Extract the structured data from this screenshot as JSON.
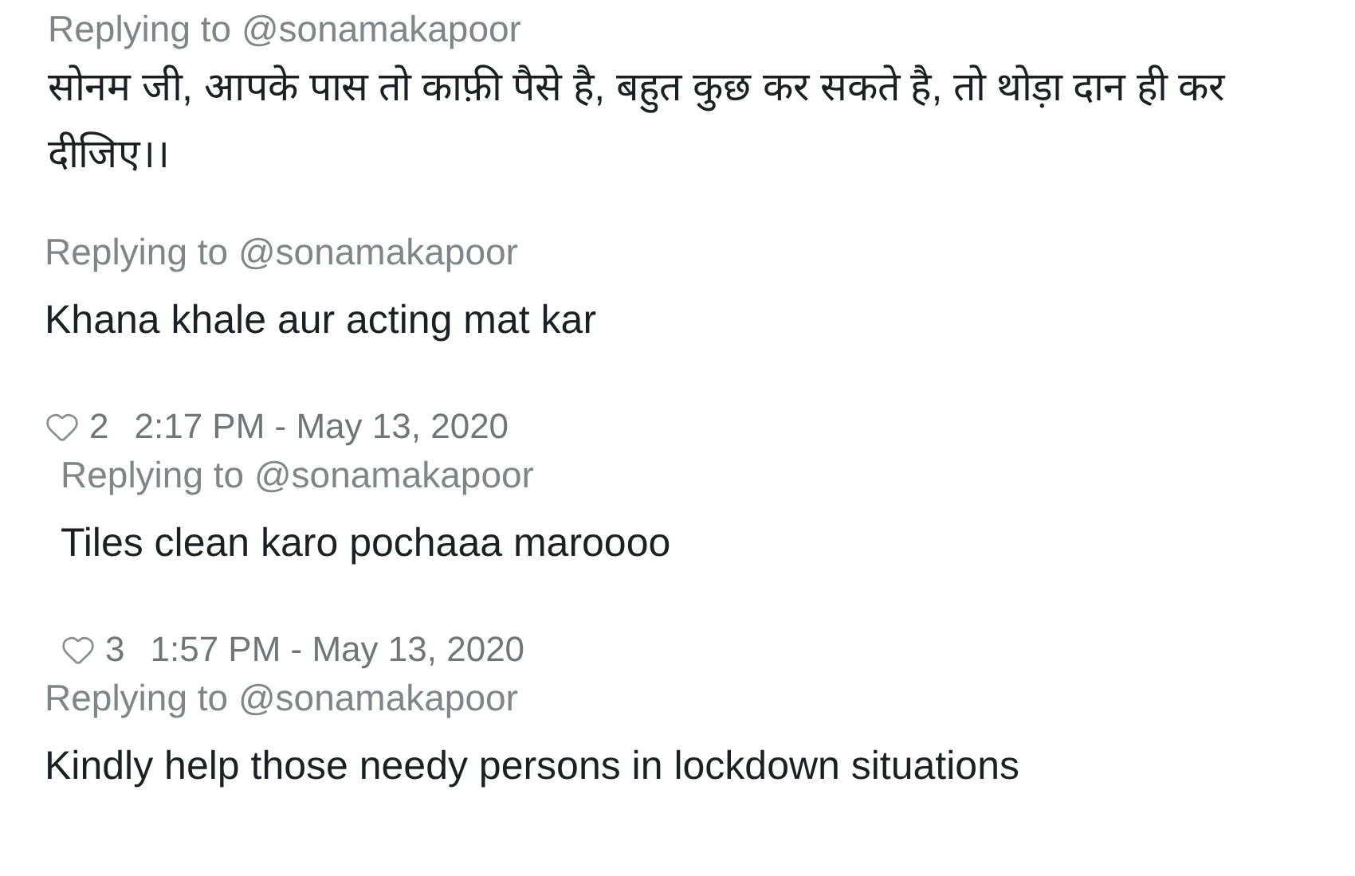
{
  "replies": [
    {
      "replying_to": "Replying to @sonamakapoor",
      "text": "सोनम जी, आपके पास तो काफ़ी पैसे है, बहुत कुछ कर सकते है, तो थोड़ा दान ही कर दीजिए।।"
    },
    {
      "replying_to": "Replying to @sonamakapoor",
      "text": "Khana khale aur acting mat kar",
      "likes": "2",
      "timestamp": "2:17 PM - May 13, 2020"
    },
    {
      "replying_to": "Replying to @sonamakapoor",
      "text": "Tiles clean karo pochaaa maroooo",
      "likes": "3",
      "timestamp": "1:57 PM - May 13, 2020"
    },
    {
      "replying_to": "Replying to @sonamakapoor",
      "text": "Kindly help those needy persons in lockdown situations"
    }
  ]
}
